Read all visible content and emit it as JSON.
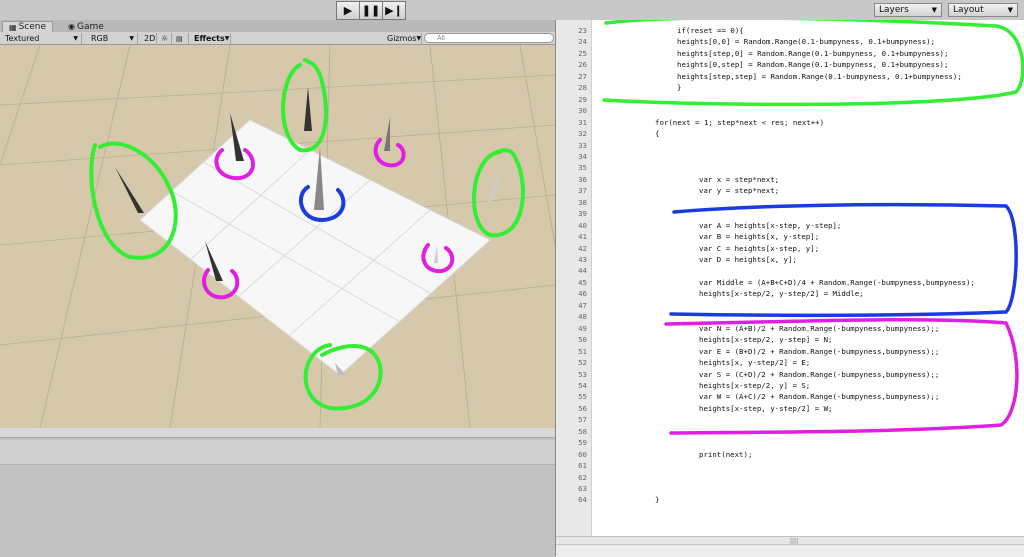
{
  "toolbar": {
    "play_icon": "play-icon",
    "pause_icon": "pause-icon",
    "step_icon": "step-icon",
    "layers_label": "Layers",
    "layout_label": "Layout"
  },
  "tabs": [
    {
      "label": "Scene",
      "icon": "scene-icon",
      "active": true
    },
    {
      "label": "Game",
      "icon": "game-icon",
      "active": false
    }
  ],
  "scene_toolbar": {
    "render_mode": "Textured",
    "color_mode": "RGB",
    "toggle_2d": "2D",
    "lighting_icon": "sun-icon",
    "audio_icon": "speaker-icon",
    "effects_label": "Effects",
    "gizmos_label": "Gizmos",
    "search_placeholder": "All"
  },
  "code": [
    {
      "n": "23",
      "t": "if(reset == 0){",
      "indent": 2
    },
    {
      "n": "24",
      "t": "heights[0,0] = Random.Range(0.1-bumpyness, 0.1+bumpyness);",
      "indent": 2
    },
    {
      "n": "25",
      "t": "heights[step,0] = Random.Range(0.1-bumpyness, 0.1+bumpyness);",
      "indent": 2
    },
    {
      "n": "26",
      "t": "heights[0,step] = Random.Range(0.1-bumpyness, 0.1+bumpyness);",
      "indent": 2
    },
    {
      "n": "27",
      "t": "heights[step,step] = Random.Range(0.1-bumpyness, 0.1+bumpyness);",
      "indent": 2
    },
    {
      "n": "28",
      "t": "}",
      "indent": 2
    },
    {
      "n": "29",
      "t": "",
      "indent": 0
    },
    {
      "n": "30",
      "t": "",
      "indent": 0
    },
    {
      "n": "31",
      "t": "for(next = 1; step*next < res; next++)",
      "indent": 1
    },
    {
      "n": "32",
      "t": "{",
      "indent": 1
    },
    {
      "n": "33",
      "t": "",
      "indent": 0
    },
    {
      "n": "34",
      "t": "",
      "indent": 0
    },
    {
      "n": "35",
      "t": "",
      "indent": 0
    },
    {
      "n": "36",
      "t": "var x = step*next;",
      "indent": 3
    },
    {
      "n": "37",
      "t": "var y = step*next;",
      "indent": 3
    },
    {
      "n": "38",
      "t": "",
      "indent": 0
    },
    {
      "n": "39",
      "t": "",
      "indent": 0
    },
    {
      "n": "40",
      "t": "var A = heights[x-step, y-step];",
      "indent": 3
    },
    {
      "n": "41",
      "t": "var B = heights[x, y-step];",
      "indent": 3
    },
    {
      "n": "42",
      "t": "var C = heights[x-step, y];",
      "indent": 3
    },
    {
      "n": "43",
      "t": "var D = heights[x, y];",
      "indent": 3
    },
    {
      "n": "44",
      "t": "",
      "indent": 0
    },
    {
      "n": "45",
      "t": "var Middle = (A+B+C+D)/4 + Random.Range(-bumpyness,bumpyness);",
      "indent": 3
    },
    {
      "n": "46",
      "t": "heights[x-step/2, y-step/2] = Middle;",
      "indent": 3
    },
    {
      "n": "47",
      "t": "",
      "indent": 0
    },
    {
      "n": "48",
      "t": "",
      "indent": 0
    },
    {
      "n": "49",
      "t": "var N = (A+B)/2 + Random.Range(-bumpyness,bumpyness);;",
      "indent": 3
    },
    {
      "n": "50",
      "t": "heights[x-step/2, y-step] = N;",
      "indent": 3
    },
    {
      "n": "51",
      "t": "var E = (B+D)/2 + Random.Range(-bumpyness,bumpyness);;",
      "indent": 3
    },
    {
      "n": "52",
      "t": "heights[x, y-step/2] = E;",
      "indent": 3
    },
    {
      "n": "53",
      "t": "var S = (C+D)/2 + Random.Range(-bumpyness,bumpyness);;",
      "indent": 3
    },
    {
      "n": "54",
      "t": "heights[x-step/2, y] = S;",
      "indent": 3
    },
    {
      "n": "55",
      "t": "var W = (A+C)/2 + Random.Range(-bumpyness,bumpyness);;",
      "indent": 3
    },
    {
      "n": "56",
      "t": "heights[x-step, y-step/2] = W;",
      "indent": 3
    },
    {
      "n": "57",
      "t": "",
      "indent": 0
    },
    {
      "n": "58",
      "t": "",
      "indent": 0
    },
    {
      "n": "59",
      "t": "",
      "indent": 0
    },
    {
      "n": "60",
      "t": "print(next);",
      "indent": 3
    },
    {
      "n": "61",
      "t": "",
      "indent": 0
    },
    {
      "n": "62",
      "t": "",
      "indent": 0
    },
    {
      "n": "63",
      "t": "",
      "indent": 0
    },
    {
      "n": "64",
      "t": "}",
      "indent": 1
    }
  ],
  "annotation_colors": {
    "green": "#33ee33",
    "blue": "#1a3bdd",
    "magenta": "#e020e0"
  }
}
